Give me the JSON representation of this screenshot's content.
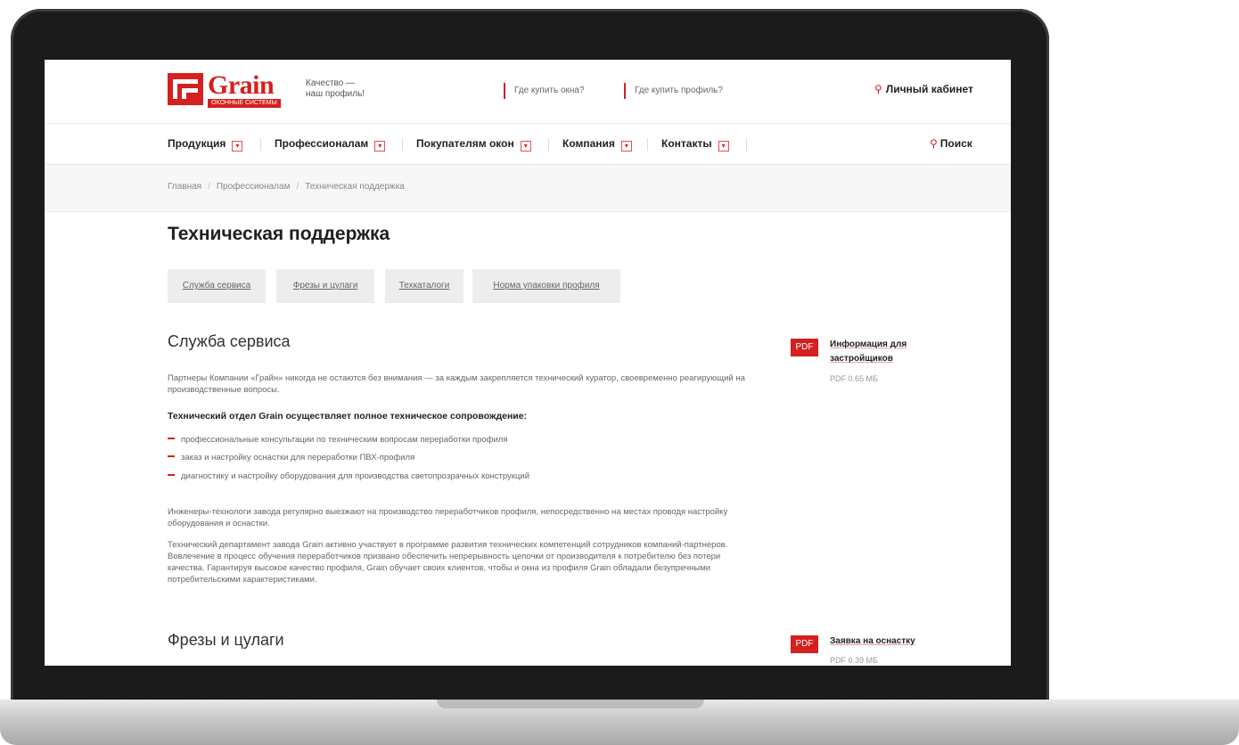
{
  "header": {
    "logo_word": "Grain",
    "logo_sub": "ОКОННЫЕ СИСТЕМЫ",
    "slogan_line1": "Качество —",
    "slogan_line2": "наш профиль!",
    "link_windows": "Где купить окна?",
    "link_profile": "Где купить профиль?",
    "cabinet_label": "Личный кабинет"
  },
  "nav": {
    "items": [
      {
        "label": "Продукция"
      },
      {
        "label": "Профессионалам"
      },
      {
        "label": "Покупателям окон"
      },
      {
        "label": "Компания"
      },
      {
        "label": "Контакты"
      }
    ],
    "search_label": "Поиск"
  },
  "breadcrumb": [
    "Главная",
    "Профессионалам",
    "Техническая поддержка"
  ],
  "page_title": "Техническая поддержка",
  "tabs": [
    "Служба сервиса",
    "Фрезы и цулаги",
    "Техкаталоги",
    "Норма упаковки профиля"
  ],
  "section_service": {
    "heading": "Служба сервиса",
    "intro": "Партнеры Компании «Грайн» никогда не остаются без внимания — за каждым закрепляется технический куратор, своевременно реагирующий на производственные вопросы.",
    "bold": "Технический отдел Grain осуществляет полное техническое сопровождение:",
    "list": [
      "профессиональные консультации по техническим вопросам переработки профиля",
      "заказ и настройку оснастки для переработки ПВХ-профиля",
      "диагностику и настройку оборудования для производства светопрозрачных конструкций"
    ],
    "para2": "Инженеры-технологи завода регулярно выезжают на производство переработчиков профиля, непосредственно на местах проводя настройку оборудования и оснастки.",
    "para3": "Технический департамент завода Grain активно участвует в программе развития технических компетенций сотрудников компаний-партнеров. Вовлечение в процесс обучения переработчиков призвано обеспечить непрерывность цепочки от производителя к потребителю без потери качества. Гарантируя высокое качество профиля, Grain обучает своих клиентов, чтобы и окна из профиля Grain обладали безупречными потребительскими характеристиками."
  },
  "section_mills": {
    "heading": "Фрезы и цулаги"
  },
  "files": [
    {
      "badge": "PDF",
      "title_line1": "Информация для",
      "title_line2": "застройщиков",
      "meta": "PDF 0.65 МБ"
    },
    {
      "badge": "PDF",
      "title_line1": "Заявка на оснастку",
      "meta": "PDF 0.39 МБ"
    }
  ],
  "colors": {
    "accent": "#d4201e",
    "text": "#222222",
    "muted": "#666666",
    "tab_bg": "#ededed"
  }
}
